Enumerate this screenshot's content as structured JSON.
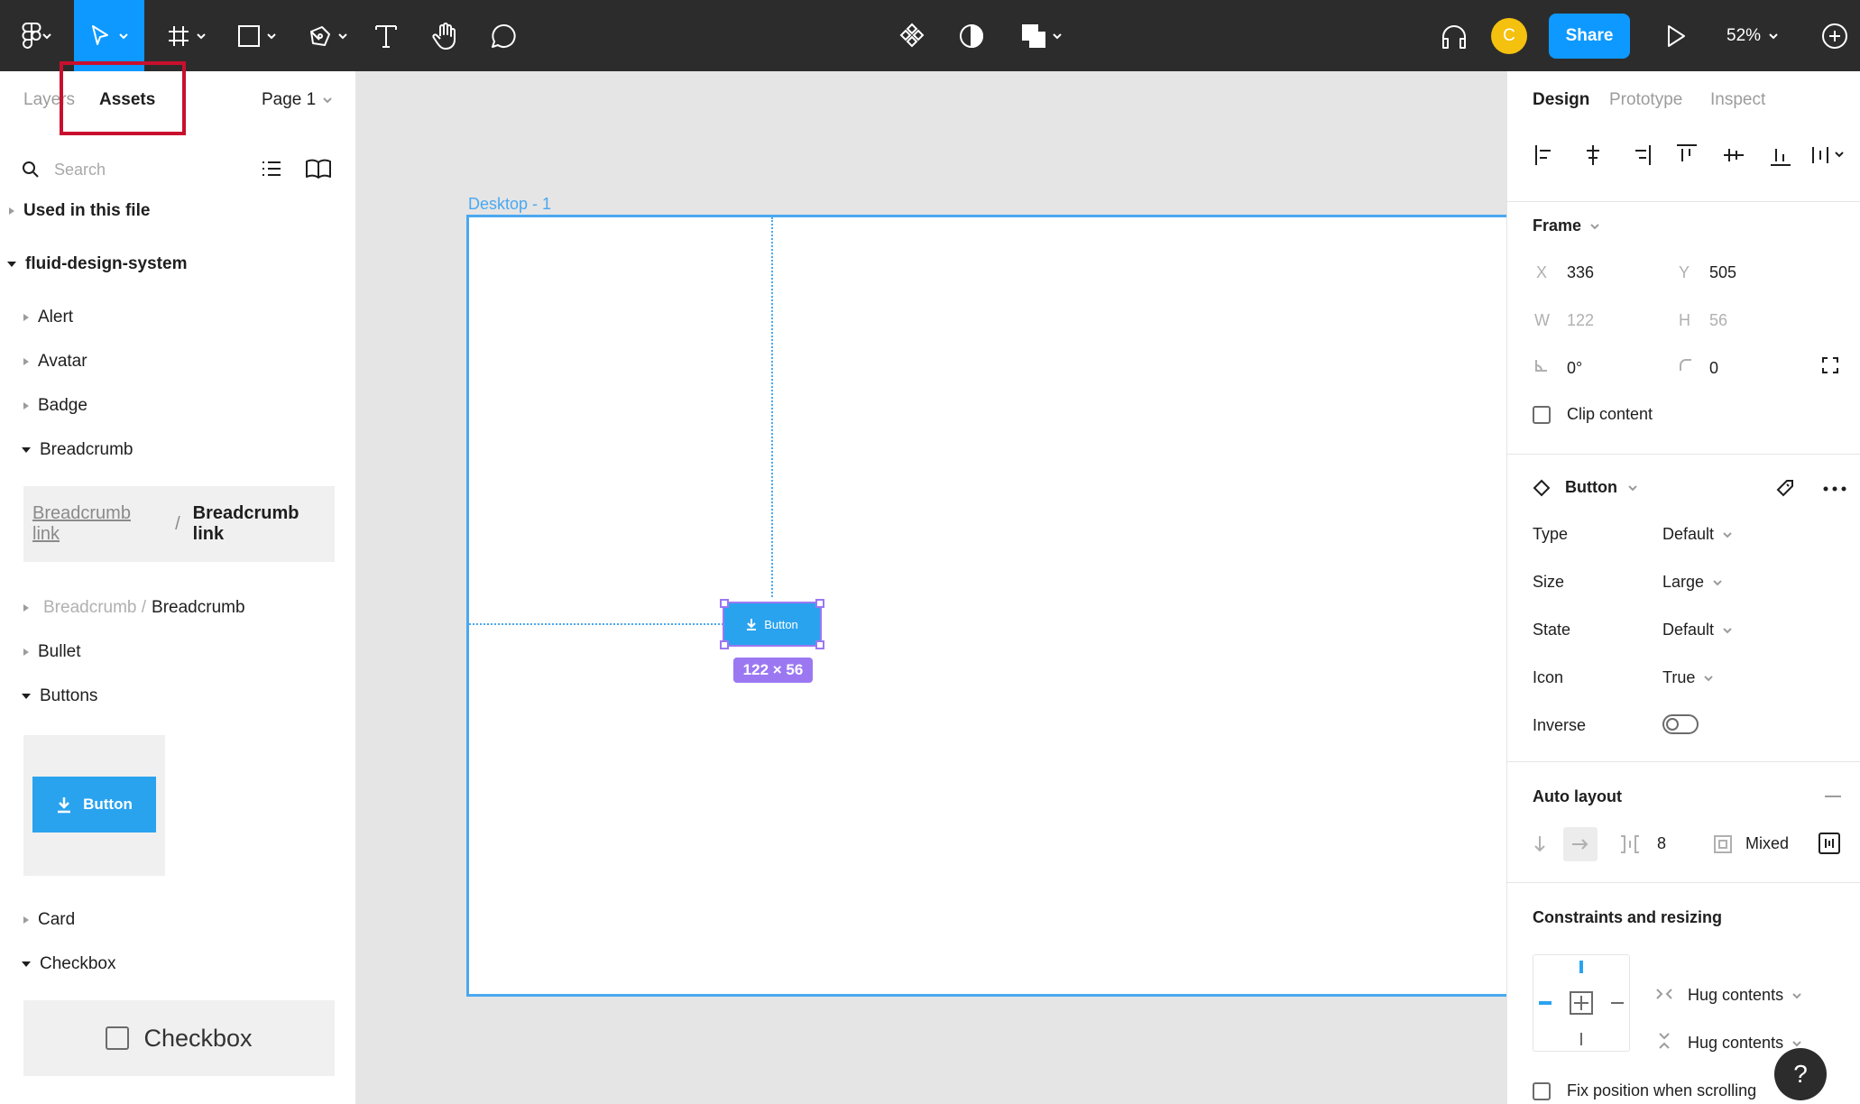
{
  "toolbar": {
    "share_label": "Share",
    "avatar_initial": "C",
    "zoom_label": "52%",
    "accent_color": "#0d99ff"
  },
  "left_panel": {
    "tabs": {
      "layers": "Layers",
      "assets": "Assets"
    },
    "page_label": "Page 1",
    "search_placeholder": "Search",
    "used_in_file": "Used in this file",
    "library_name": "fluid-design-system",
    "items": {
      "alert": "Alert",
      "avatar": "Avatar",
      "badge": "Badge",
      "breadcrumb": "Breadcrumb",
      "breadcrumb_sub_1": "Breadcrumb /",
      "breadcrumb_sub_2": "Breadcrumb",
      "bullet": "Bullet",
      "buttons": "Buttons",
      "card": "Card",
      "checkbox": "Checkbox"
    },
    "breadcrumb_preview": {
      "link1": "Breadcrumb link",
      "separator": "/",
      "link2": "Breadcrumb link"
    },
    "button_preview_label": "Button",
    "checkbox_preview_label": "Checkbox"
  },
  "canvas": {
    "frame_label": "Desktop - 1",
    "selected_button_label": "Button",
    "dimension_badge": "122 × 56",
    "selection_color": "#9b78f2",
    "frame_color": "#4aa8f0"
  },
  "right_panel": {
    "tabs": {
      "design": "Design",
      "prototype": "Prototype",
      "inspect": "Inspect"
    },
    "frame": {
      "title": "Frame",
      "x_label": "X",
      "x_value": "336",
      "y_label": "Y",
      "y_value": "505",
      "w_label": "W",
      "w_value": "122",
      "h_label": "H",
      "h_value": "56",
      "rotation": "0°",
      "radius": "0",
      "clip_content": "Clip content"
    },
    "component": {
      "name": "Button",
      "props": [
        {
          "label": "Type",
          "value": "Default"
        },
        {
          "label": "Size",
          "value": "Large"
        },
        {
          "label": "State",
          "value": "Default"
        },
        {
          "label": "Icon",
          "value": "True"
        },
        {
          "label": "Inverse",
          "value": ""
        }
      ]
    },
    "auto_layout": {
      "title": "Auto layout",
      "spacing": "8",
      "padding": "Mixed"
    },
    "constraints": {
      "title": "Constraints and resizing",
      "horizontal": "Hug contents",
      "vertical": "Hug contents",
      "fix_position": "Fix position when scrolling"
    }
  },
  "help_label": "?"
}
